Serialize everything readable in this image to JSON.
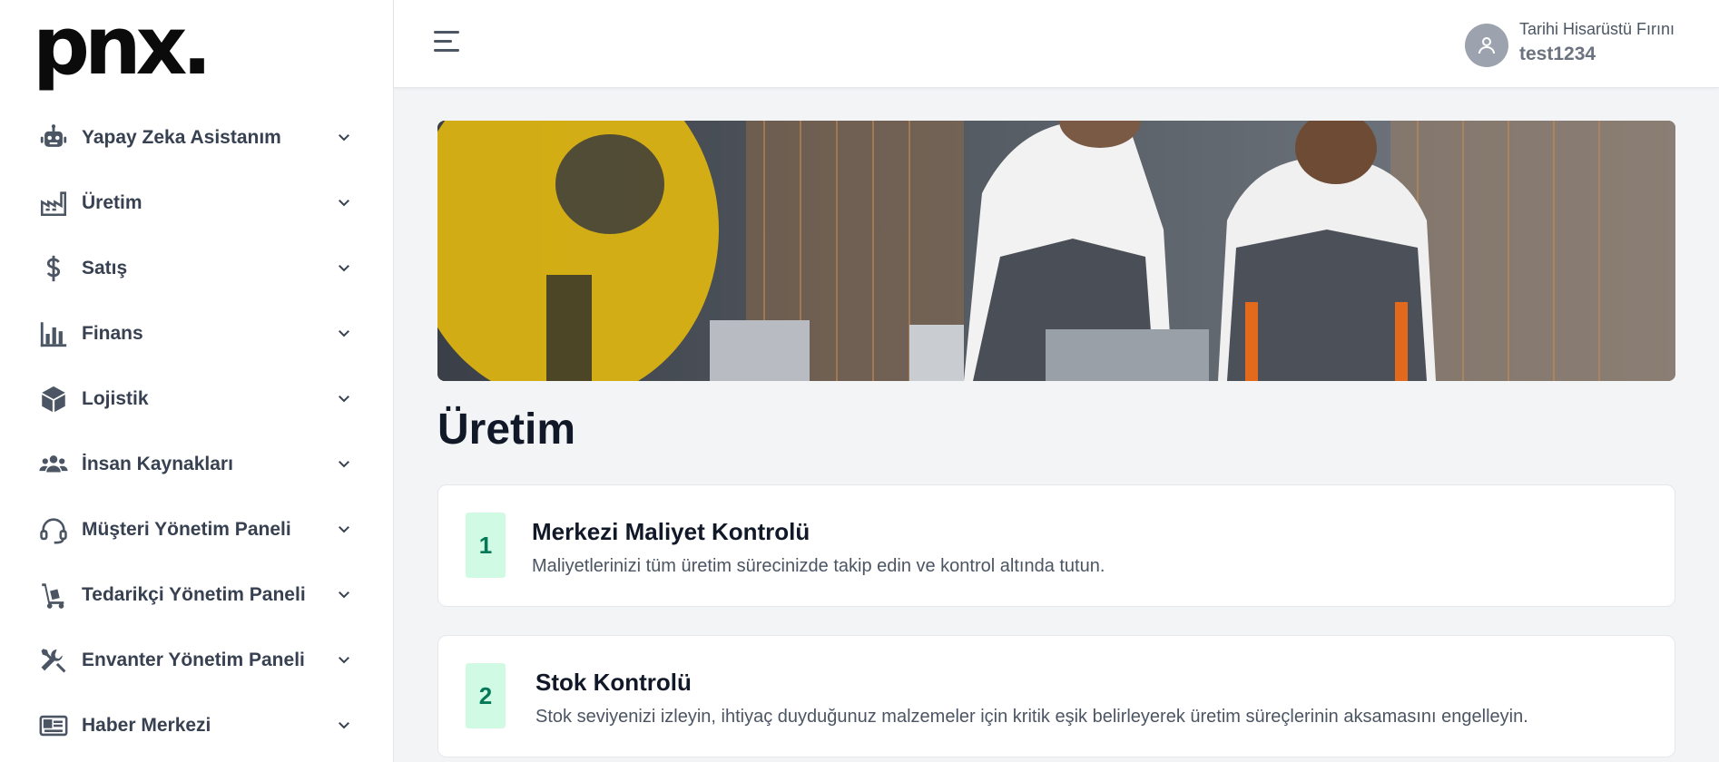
{
  "brand": {
    "logo_text": "pnx."
  },
  "sidebar": {
    "items": [
      {
        "label": "Yapay Zeka Asistanım",
        "icon": "robot-icon"
      },
      {
        "label": "Üretim",
        "icon": "factory-icon"
      },
      {
        "label": "Satış",
        "icon": "dollar-icon"
      },
      {
        "label": "Finans",
        "icon": "bar-chart-icon"
      },
      {
        "label": "Lojistik",
        "icon": "box-icon"
      },
      {
        "label": "İnsan Kaynakları",
        "icon": "users-icon"
      },
      {
        "label": "Müşteri Yönetim Paneli",
        "icon": "headset-icon"
      },
      {
        "label": "Tedarikçi Yönetim Paneli",
        "icon": "hand-truck-icon"
      },
      {
        "label": "Envanter Yönetim Paneli",
        "icon": "tools-icon"
      },
      {
        "label": "Haber Merkezi",
        "icon": "newspaper-icon"
      }
    ]
  },
  "header": {
    "organization": "Tarihi Hisarüstü Fırını",
    "username": "test1234"
  },
  "main": {
    "title": "Üretim",
    "steps": [
      {
        "number": "1",
        "title": "Merkezi Maliyet Kontrolü",
        "description": "Maliyetlerinizi tüm üretim sürecinizde takip edin ve kontrol altında tutun."
      },
      {
        "number": "2",
        "title": "Stok Kontrolü",
        "description": "Stok seviyenizi izleyin, ihtiyaç duyduğunuz malzemeler için kritik eşik belirleyerek üretim süreçlerinin aksamasını engelleyin."
      }
    ]
  },
  "colors": {
    "accent_green_bg": "#d1fae5",
    "accent_green_text": "#047857",
    "sidebar_text": "#374151"
  }
}
